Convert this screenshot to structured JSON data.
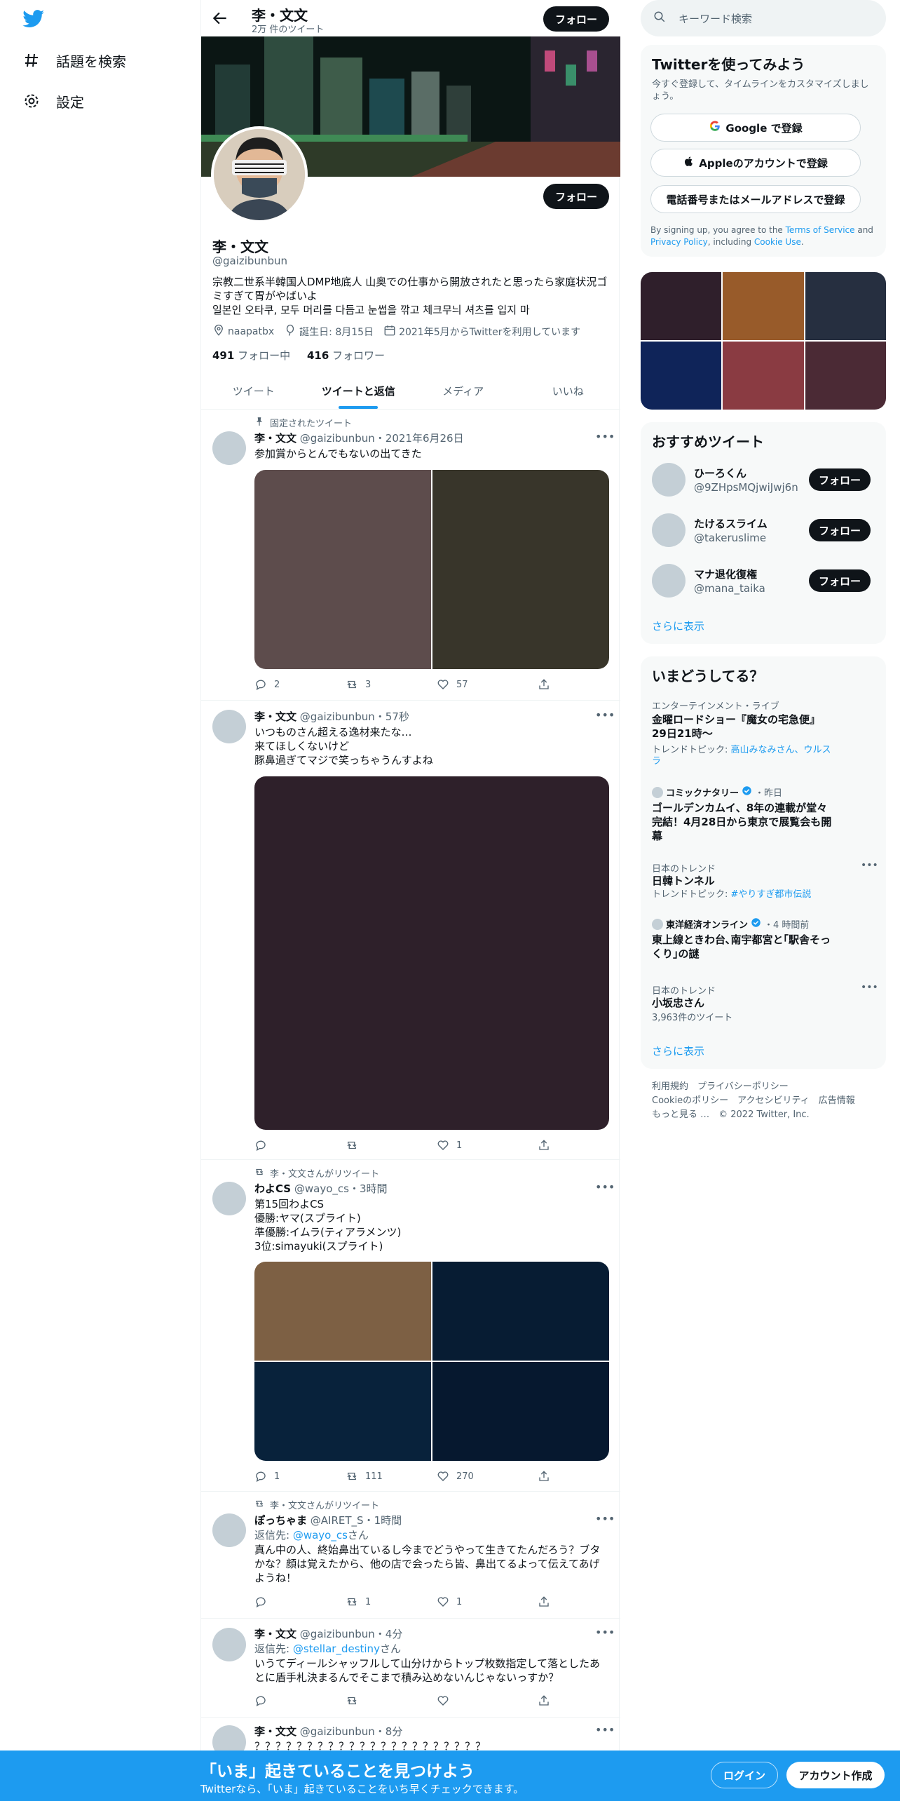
{
  "nav": {
    "explore_label": "話題を検索",
    "settings_label": "設定"
  },
  "topbar": {
    "name": "李・文文",
    "tweet_count": "2万 件のツイート",
    "follow_label": "フォロー"
  },
  "profile": {
    "follow_label": "フォロー",
    "name": "李・文文",
    "handle": "@gaizibunbun",
    "bio_line1": "宗教二世系半韓国人DMP地底人 山奥での仕事から開放されたと思ったら家庭状況ゴミすぎて胃がやばいよ",
    "bio_line2": "일본인 오타쿠, 모두 머리를 다듬고 눈썹을 깎고 체크무늬 셔츠를 입지 마",
    "location": "naapatbx",
    "birthday": "誕生日: 8月15日",
    "joined": "2021年5月からTwitterを利用しています",
    "following_count": "491",
    "following_label": "フォロー中",
    "followers_count": "416",
    "followers_label": "フォロワー"
  },
  "tabs": [
    "ツイート",
    "ツイートと返信",
    "メディア",
    "いいね"
  ],
  "active_tab": "ツイートと返信",
  "tweets": [
    {
      "pretext": "固定されたツイート",
      "name": "李・文文",
      "meta": "@gaizibunbun・2021年6月26日",
      "text": "参加賞からとんでもないの出てきた",
      "replies": "2",
      "retweets": "3",
      "likes": "57",
      "media_colors": [
        "#5d4c4c",
        "#38352a"
      ]
    },
    {
      "name": "李・文文",
      "meta": "@gaizibunbun・57秒",
      "text": "いつものさん超える逸材来たな…\n来てほしくないけど\n豚鼻過ぎてマジで笑っちゃうんすよね",
      "replies": "",
      "retweets": "",
      "likes": "1",
      "media_colors": [
        "#2e202a"
      ]
    },
    {
      "pretext": "李・文文さんがリツイート",
      "name": "わよCS",
      "meta": "@wayo_cs・3時間",
      "text": "第15回わよCS\n優勝:ヤマ(スプライト)\n準優勝:イムラ(ティアラメンツ)\n3位:simayuki(スプライト)",
      "replies": "1",
      "retweets": "111",
      "likes": "270",
      "media_colors": [
        "#7d6044",
        "#071c33",
        "#08223b",
        "#06182f"
      ]
    },
    {
      "pretext": "李・文文さんがリツイート",
      "name": "ぽっちゃま",
      "meta": "@AIRET_S・1時間",
      "reply_prefix": "返信先: ",
      "reply_to": "@wayo_cs",
      "reply_suffix": "さん",
      "text": "真ん中の人、終始鼻出ているし今までどうやって生きてたんだろう？ブタかな？顔は覚えたから、他の店で会ったら皆、鼻出てるよって伝えてあげようね！",
      "replies": "",
      "retweets": "1",
      "likes": "1"
    },
    {
      "name": "李・文文",
      "meta": "@gaizibunbun・4分",
      "reply_prefix": "返信先: ",
      "reply_to": "@stellar_destiny",
      "reply_suffix": "さん",
      "text": "いうてディールシャッフルして山分けからトップ枚数指定して落としたあとに盾手札決まるんでそこまで積み込めないんじゃないっすか？",
      "replies": "",
      "retweets": "",
      "likes": ""
    },
    {
      "name": "李・文文",
      "meta": "@gaizibunbun・8分",
      "text": "？？？？？？？？？？？？？？？？？？？？？？"
    }
  ],
  "search": {
    "placeholder": "キーワード検索"
  },
  "signup": {
    "title": "Twitterを使ってみよう",
    "subtitle": "今すぐ登録して、タイムラインをカスタマイズしましょう。",
    "google": "Google で登録",
    "apple": "Appleのアカウントで登録",
    "phone": "電話番号またはメールアドレスで登録",
    "terms_pre": "By signing up, you agree to the ",
    "terms": "Terms of Service",
    "terms_and": " and ",
    "privacy": "Privacy Policy",
    "terms_including": ", including ",
    "cookie": "Cookie Use",
    "terms_end": "."
  },
  "media_grid_colors": [
    "#2f1f2b",
    "#985b2a",
    "#262f40",
    "#0f2459",
    "#8a3b42",
    "#4b2a35"
  ],
  "recommended": {
    "title": "おすすめツイート",
    "users": [
      {
        "name": "ひーろくん",
        "handle": "@9ZHpsMQjwiJwj6n"
      },
      {
        "name": "たけるスライム",
        "handle": "@takeruslime"
      },
      {
        "name": "マナ退化復権",
        "handle": "@mana_taika"
      }
    ],
    "follow_label": "フォロー",
    "more": "さらに表示"
  },
  "trends": {
    "title": "いまどうしてる？",
    "items": [
      {
        "cat": "エンターテインメント・ライブ",
        "title": "金曜ロードショー『魔女の宅急便』29日21時〜",
        "sub_pre": "トレンドトピック: ",
        "sub_link": "高山みなみさん、ウルスラ"
      },
      {
        "source": "コミックナタリー",
        "time": "・昨日",
        "title": "ゴールデンカムイ、8年の連載が堂々完結！4月28日から東京で展覧会も開幕"
      },
      {
        "cat": "日本のトレンド",
        "title": "日韓トンネル",
        "sub_pre": "トレンドトピック: ",
        "sub_link": "#やりすぎ都市伝説"
      },
      {
        "source": "東洋経済オンライン",
        "time": "・4 時間前",
        "title": "東上線ときわ台､南宇都宮と｢駅舎そっくり｣の謎"
      },
      {
        "cat": "日本のトレンド",
        "title": "小坂忠さん",
        "sub": "3,963件のツイート"
      }
    ],
    "more": "さらに表示"
  },
  "footer": {
    "line1": "利用規約　プライバシーポリシー",
    "line2": "Cookieのポリシー　アクセシビリティ　広告情報",
    "line3": "もっと見る …　© 2022 Twitter, Inc."
  },
  "bottom": {
    "title": "「いま」起きていることを見つけよう",
    "subtitle": "Twitterなら、「いま」起きていることをいち早くチェックできます。",
    "login": "ログイン",
    "signup": "アカウント作成"
  }
}
